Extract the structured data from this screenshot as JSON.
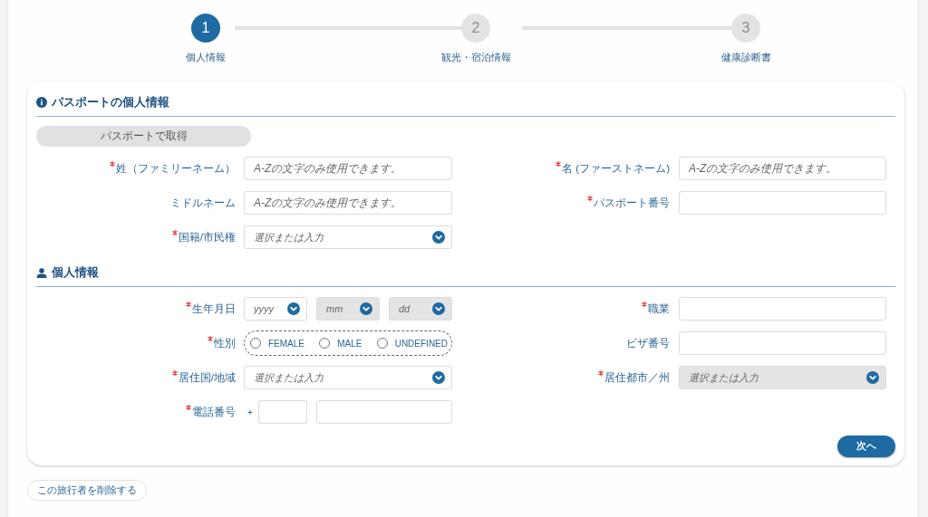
{
  "steps": [
    {
      "number": "1",
      "label": "個人情報",
      "selected": true
    },
    {
      "number": "2",
      "label": "観光・宿泊情報",
      "selected": false
    },
    {
      "number": "3",
      "label": "健康診断書",
      "selected": false
    }
  ],
  "sections": [
    {
      "kind": "info",
      "title": "パスポートの個人情報",
      "fetch_button": {
        "label": "パスポートで取得",
        "disabled": true
      },
      "rows": [
        {
          "left": {
            "label": "姓（ファミリーネーム）",
            "required": true,
            "kind": "text",
            "placeholder": "A-Zの文字のみ使用できます。"
          },
          "right": {
            "label": "名 (ファーストネーム)",
            "required": true,
            "kind": "text",
            "placeholder": "A-Zの文字のみ使用できます。"
          }
        },
        {
          "left": {
            "label": "ミドルネーム",
            "required": false,
            "kind": "text",
            "placeholder": "A-Zの文字のみ使用できます。"
          },
          "right": {
            "label": "パスポート番号",
            "required": true,
            "kind": "text"
          }
        },
        {
          "left": {
            "label": "国籍/市民権",
            "required": true,
            "kind": "select",
            "placeholder": "選択または入力",
            "disabled": false
          }
        }
      ]
    },
    {
      "kind": "person",
      "title": "個人情報",
      "rows": [
        {
          "left": {
            "label": "生年月日",
            "required": true,
            "kind": "date",
            "parts": [
              {
                "placeholder": "yyyy",
                "disabled": false
              },
              {
                "placeholder": "mm",
                "disabled": true
              },
              {
                "placeholder": "dd",
                "disabled": true
              }
            ]
          },
          "right": {
            "label": "職業",
            "required": true,
            "kind": "text"
          }
        },
        {
          "left": {
            "label": "性別",
            "required": true,
            "kind": "radio",
            "options": [
              {
                "label": "FEMALE",
                "selected": false
              },
              {
                "label": "MALE",
                "selected": false
              },
              {
                "label": "UNDEFINED",
                "selected": false
              }
            ]
          },
          "right": {
            "label": "ビザ番号",
            "required": false,
            "kind": "text"
          }
        },
        {
          "left": {
            "label": "居住国/地域",
            "required": true,
            "kind": "select",
            "placeholder": "選択または入力",
            "disabled": false
          },
          "right": {
            "label": "居住都市／州",
            "required": true,
            "kind": "select",
            "placeholder": "選択または入力",
            "disabled": true
          }
        },
        {
          "left": {
            "label": "電話番号",
            "required": true,
            "kind": "phone",
            "prefix": "+"
          }
        }
      ]
    }
  ],
  "next_button": "次へ",
  "delete_button": "この旅行者を削除する"
}
